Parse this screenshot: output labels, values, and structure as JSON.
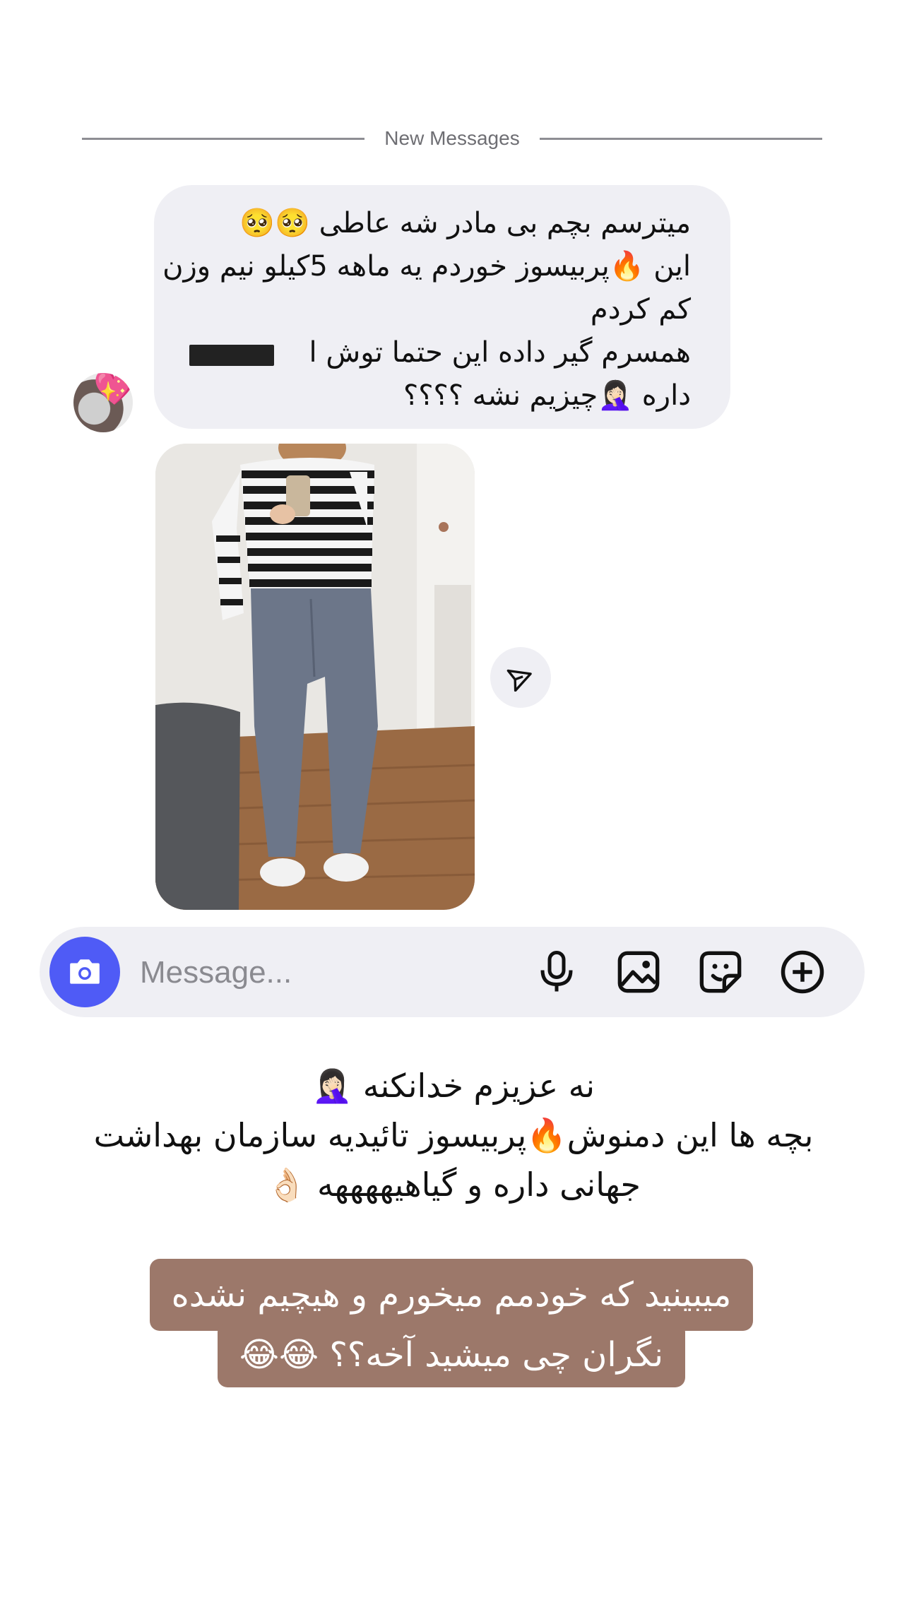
{
  "divider": {
    "label": "New Messages"
  },
  "message": {
    "lines": [
      "میترسم بچم بی مادر شه عاطی 🥺🥺",
      "این 🔥پربیسوز خوردم یه ماهه 5کیلو نیم وزن",
      "کم کردم",
      "همسرم گیر داده این حتما توش ا",
      "داره 🤦🏻‍♀️چیزیم نشه ؟؟؟؟"
    ]
  },
  "composer": {
    "placeholder": "Message..."
  },
  "icons": {
    "avatar_sticker": "sparkling-heart-icon",
    "forward": "send-icon",
    "camera": "camera-icon",
    "mic": "microphone-icon",
    "gallery": "image-icon",
    "sticker": "sticker-icon",
    "more": "plus-circle-icon"
  },
  "caption": {
    "lines": [
      "نه عزیزم خدانکنه 🤦🏻‍♀️",
      "بچه ها این دمنوش🔥پربیسوز تائیدیه سازمان بهداشت",
      "جهانی داره و گیاهیههههه 👌🏻"
    ]
  },
  "highlight": {
    "line1": "میبینید که خودمم میخورم و هیچیم نشده",
    "line2": "نگران چی میشید آخه؟؟ 😂😂"
  },
  "colors": {
    "accent": "#4f5bf6",
    "bubble": "#efeff4",
    "highlight": "#9c786a"
  }
}
